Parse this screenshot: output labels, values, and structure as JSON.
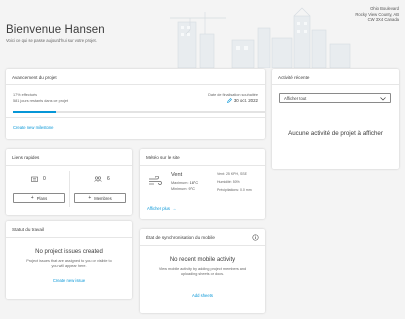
{
  "header": {
    "title": "Bienvenue Hansen",
    "subtitle": "Voici ce qui se passe aujourd'hui sur votre projet.",
    "address": [
      "Ohio Boulevard",
      "Rocky View County, AB",
      "CW 3X4 Canada"
    ]
  },
  "progress_card": {
    "title": "Avancement du projet",
    "percent_text": "17% effectués",
    "days_left_text": "581 jours restants dans ce projet",
    "end_date_label": "Date de finalisation souhaitée",
    "end_date": "30 oct. 2022",
    "progress_fraction": 0.17,
    "milestone_link": "Create new milestone"
  },
  "activity_card": {
    "title": "Activité récente",
    "filter_value": "Afficher tout",
    "empty_text": "Aucune activité de projet à afficher"
  },
  "quick_links": {
    "title": "Liens rapides",
    "plans_count": "0",
    "members_count": "6",
    "plans_label": "Plans",
    "members_label": "Membres"
  },
  "weather": {
    "title": "Météo sur le site",
    "condition": "Vent",
    "max_label": "Maximum:",
    "max_value": "18°C",
    "min_label": "Minimum:",
    "min_value": "9°C",
    "wind": "Vent: 25 KPH, SSE",
    "humidity": "Humidité: 50%",
    "precipitation": "Précipitations: 0.0 mm",
    "more_link": "Afficher plus"
  },
  "work_status": {
    "title": "Statut du travail",
    "empty_title": "No project issues created",
    "empty_text": "Project issues that are assigned to you or visible to you will appear here.",
    "link": "Create new issue"
  },
  "mobile_sync": {
    "title": "État de synchronisation du mobile",
    "empty_title": "No recent mobile activity",
    "empty_text": "View mobile activity by adding project members and uploading sheets or docs.",
    "link": "Add sheets"
  },
  "colors": {
    "accent": "#0696d7",
    "text": "#3c3c3c"
  }
}
